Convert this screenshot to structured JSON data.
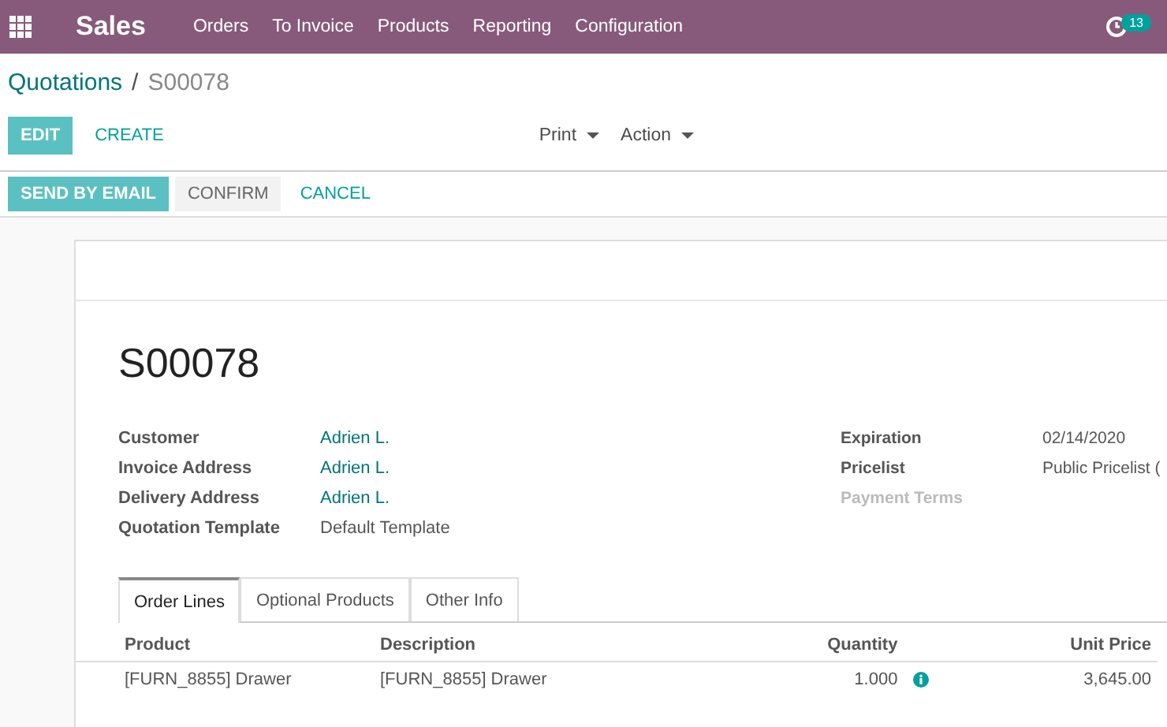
{
  "navbar": {
    "app_title": "Sales",
    "menu": [
      "Orders",
      "To Invoice",
      "Products",
      "Reporting",
      "Configuration"
    ],
    "activity_badge": "13"
  },
  "breadcrumb": {
    "parent": "Quotations",
    "separator": "/",
    "current": "S00078"
  },
  "control_panel": {
    "primary_buttons": [
      {
        "label": "EDIT",
        "kind": "primary"
      },
      {
        "label": "CREATE",
        "kind": "link"
      }
    ],
    "dropdowns": [
      "Print",
      "Action"
    ]
  },
  "status_buttons": [
    {
      "label": "SEND BY EMAIL",
      "kind": "primary"
    },
    {
      "label": "CONFIRM",
      "kind": "secondary"
    },
    {
      "label": "CANCEL",
      "kind": "link"
    }
  ],
  "sheet": {
    "title": "S00078",
    "left_fields": [
      {
        "label": "Customer",
        "value": "Adrien L.",
        "kind": "link"
      },
      {
        "label": "Invoice Address",
        "value": "Adrien L.",
        "kind": "link"
      },
      {
        "label": "Delivery Address",
        "value": "Adrien L.",
        "kind": "link"
      },
      {
        "label": "Quotation Template",
        "value": "Default Template",
        "kind": "plain"
      }
    ],
    "right_fields": [
      {
        "label": "Expiration",
        "value": "02/14/2020",
        "muted": false
      },
      {
        "label": "Pricelist",
        "value": "Public Pricelist (",
        "muted": false
      },
      {
        "label": "Payment Terms",
        "muted": true
      }
    ],
    "tabs": [
      {
        "label": "Order Lines",
        "selected": true
      },
      {
        "label": "Optional Products",
        "selected": false
      },
      {
        "label": "Other Info",
        "selected": false
      }
    ],
    "table": {
      "columns": [
        "Product",
        "Description",
        "Quantity",
        "Unit Price"
      ],
      "rows": [
        {
          "product": "[FURN_8855] Drawer",
          "description": "[FURN_8855] Drawer",
          "quantity": "1.000",
          "unit_price": "3,645.00"
        }
      ]
    }
  }
}
